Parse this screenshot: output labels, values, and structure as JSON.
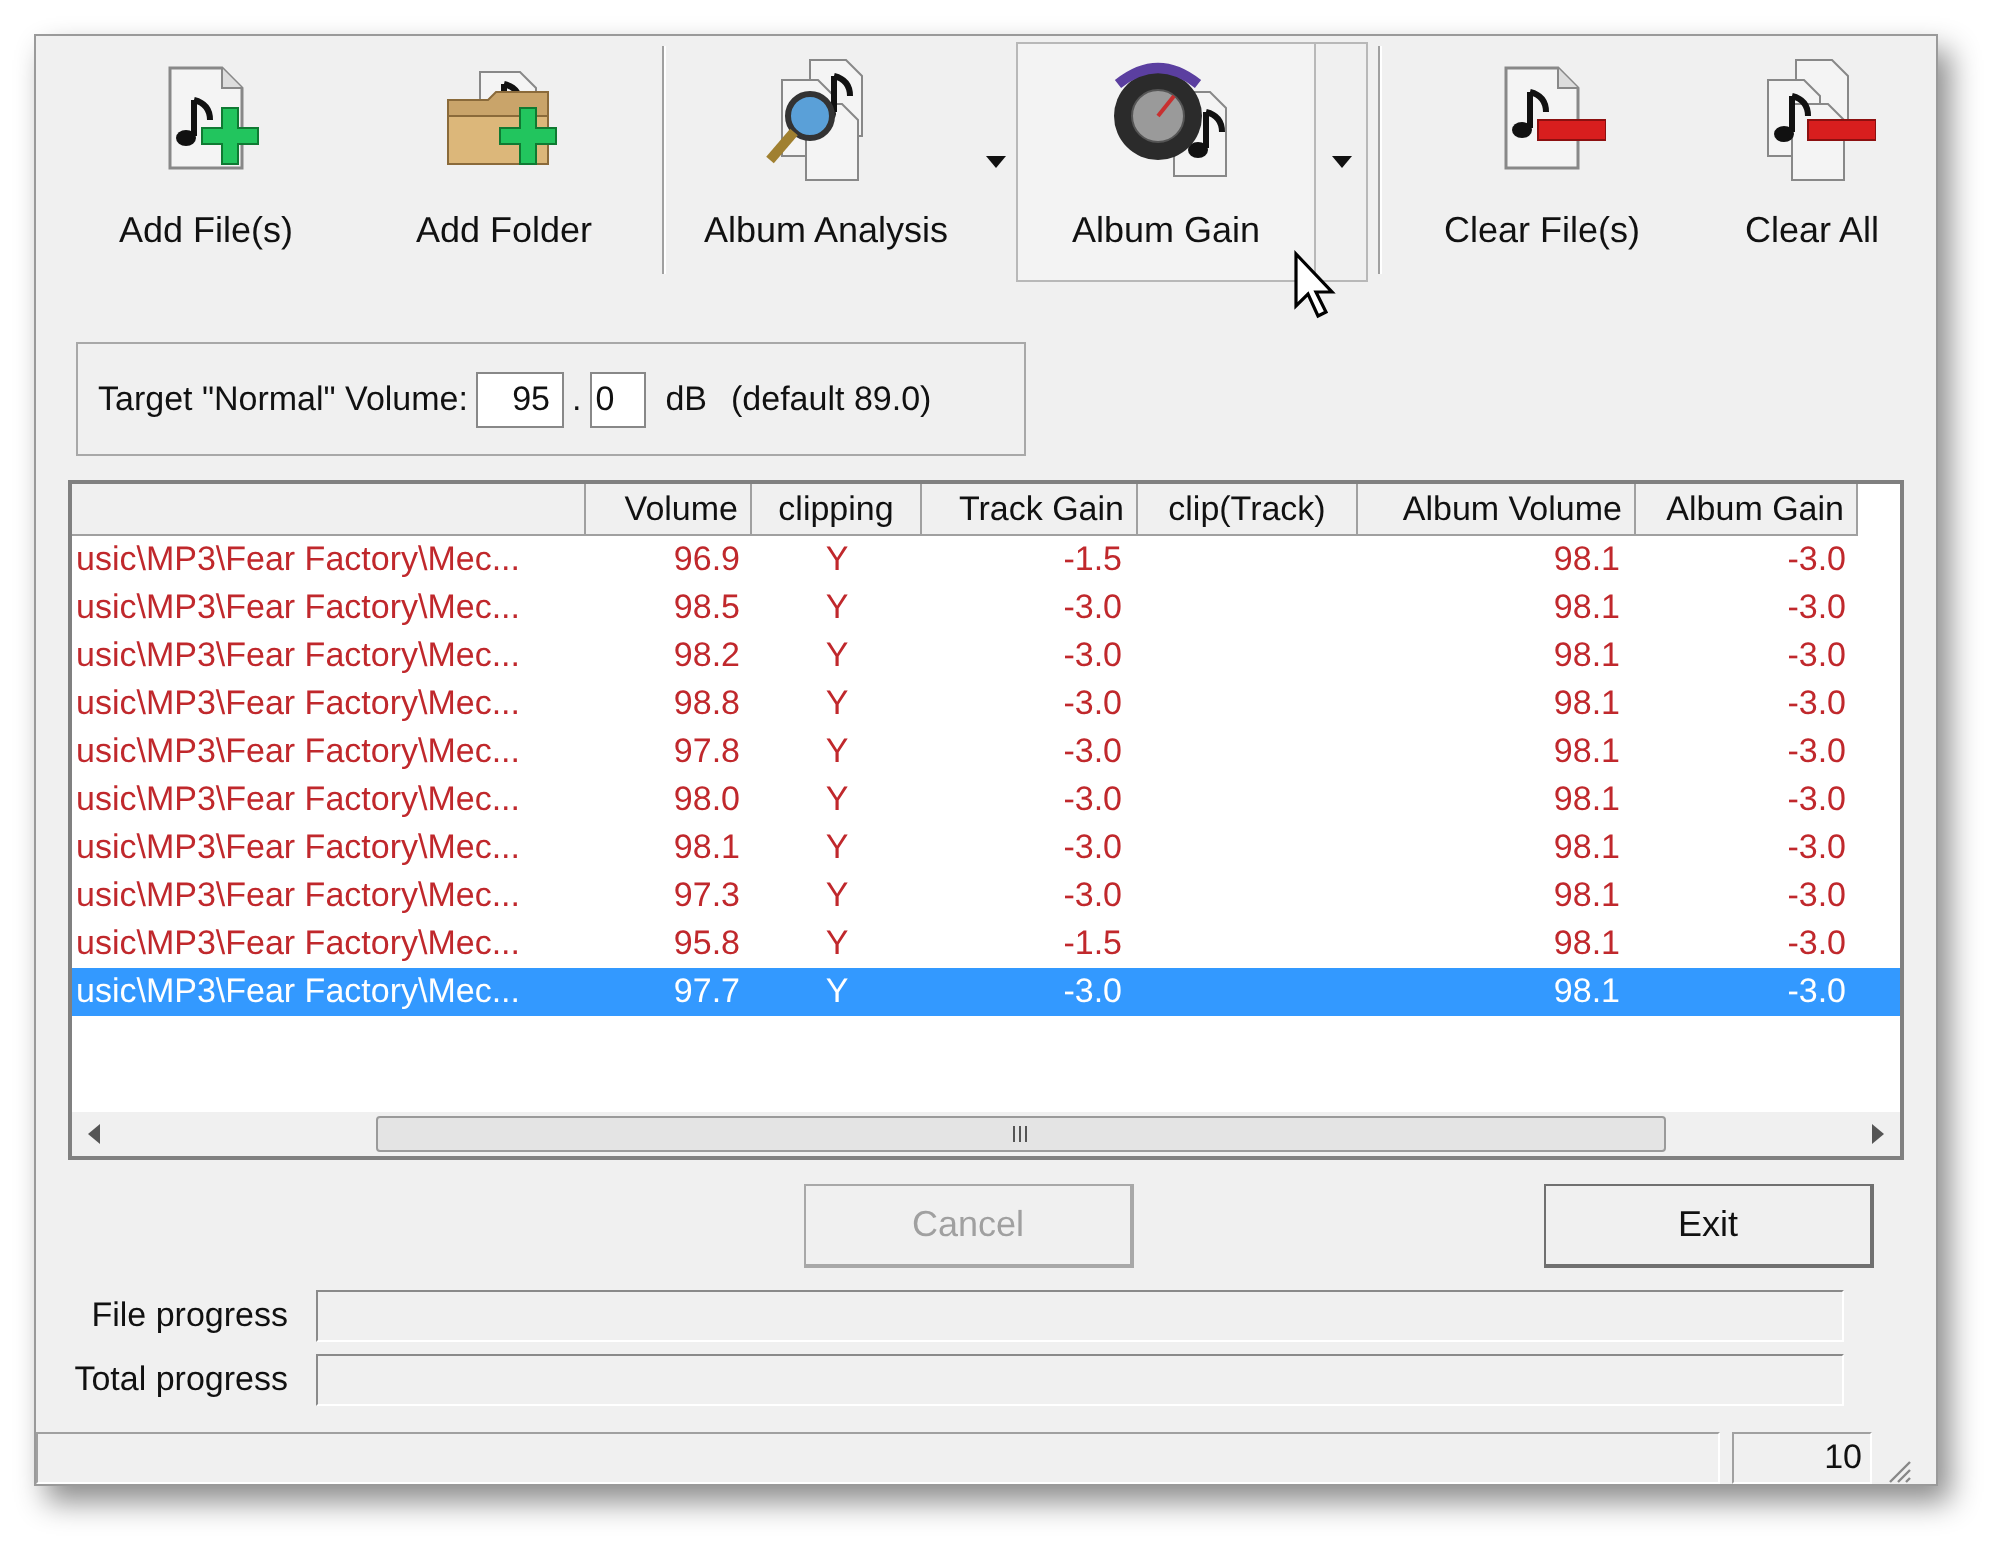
{
  "toolbar": [
    {
      "label": "Add File(s)",
      "dropdown": false,
      "hovered": false,
      "separator_after": false
    },
    {
      "label": "Add Folder",
      "dropdown": false,
      "hovered": false,
      "separator_after": true
    },
    {
      "label": "Album Analysis",
      "dropdown": true,
      "hovered": false,
      "separator_after": false
    },
    {
      "label": "Album Gain",
      "dropdown": true,
      "hovered": true,
      "separator_after": true
    },
    {
      "label": "Clear File(s)",
      "dropdown": false,
      "hovered": false,
      "separator_after": false
    },
    {
      "label": "Clear All",
      "dropdown": false,
      "hovered": false,
      "separator_after": false
    }
  ],
  "target": {
    "label": "Target \"Normal\" Volume:",
    "integer": "95",
    "separator": ".",
    "decimal": "0",
    "unit": "dB",
    "note": "(default 89.0)"
  },
  "table": {
    "columns": [
      "",
      "Volume",
      "clipping",
      "Track Gain",
      "clip(Track)",
      "Album Volume",
      "Album Gain"
    ],
    "rows": [
      {
        "cells": [
          "usic\\MP3\\Fear Factory\\Mec...",
          "96.9",
          "Y",
          "-1.5",
          "",
          "98.1",
          "-3.0"
        ],
        "selected": false
      },
      {
        "cells": [
          "usic\\MP3\\Fear Factory\\Mec...",
          "98.5",
          "Y",
          "-3.0",
          "",
          "98.1",
          "-3.0"
        ],
        "selected": false
      },
      {
        "cells": [
          "usic\\MP3\\Fear Factory\\Mec...",
          "98.2",
          "Y",
          "-3.0",
          "",
          "98.1",
          "-3.0"
        ],
        "selected": false
      },
      {
        "cells": [
          "usic\\MP3\\Fear Factory\\Mec...",
          "98.8",
          "Y",
          "-3.0",
          "",
          "98.1",
          "-3.0"
        ],
        "selected": false
      },
      {
        "cells": [
          "usic\\MP3\\Fear Factory\\Mec...",
          "97.8",
          "Y",
          "-3.0",
          "",
          "98.1",
          "-3.0"
        ],
        "selected": false
      },
      {
        "cells": [
          "usic\\MP3\\Fear Factory\\Mec...",
          "98.0",
          "Y",
          "-3.0",
          "",
          "98.1",
          "-3.0"
        ],
        "selected": false
      },
      {
        "cells": [
          "usic\\MP3\\Fear Factory\\Mec...",
          "98.1",
          "Y",
          "-3.0",
          "",
          "98.1",
          "-3.0"
        ],
        "selected": false
      },
      {
        "cells": [
          "usic\\MP3\\Fear Factory\\Mec...",
          "97.3",
          "Y",
          "-3.0",
          "",
          "98.1",
          "-3.0"
        ],
        "selected": false
      },
      {
        "cells": [
          "usic\\MP3\\Fear Factory\\Mec...",
          "95.8",
          "Y",
          "-1.5",
          "",
          "98.1",
          "-3.0"
        ],
        "selected": false
      },
      {
        "cells": [
          "usic\\MP3\\Fear Factory\\Mec...",
          "97.7",
          "Y",
          "-3.0",
          "",
          "98.1",
          "-3.0"
        ],
        "selected": true
      }
    ]
  },
  "buttons": [
    {
      "label": "Cancel",
      "disabled": true
    },
    {
      "label": "Exit",
      "disabled": false
    }
  ],
  "progress": [
    {
      "label": "File progress",
      "level": 0
    },
    {
      "label": "Total progress",
      "level": 0
    }
  ],
  "status_bar": {
    "count": "10"
  }
}
